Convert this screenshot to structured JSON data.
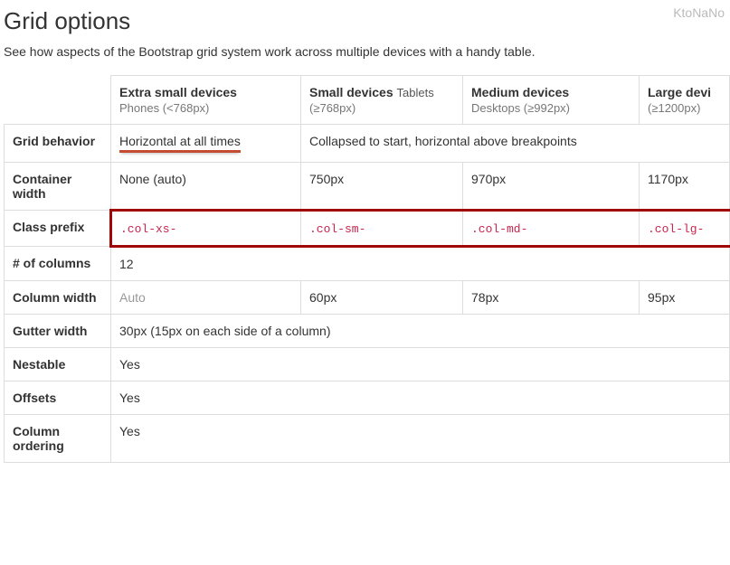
{
  "watermark": "KtoNaNo",
  "title": "Grid options",
  "lead": "See how aspects of the Bootstrap grid system work across multiple devices with a handy table.",
  "columns": [
    {
      "name": "Extra small devices",
      "tag": "",
      "sub": "Phones (<768px)"
    },
    {
      "name": "Small devices",
      "tag": "Tablets",
      "sub": "(≥768px)"
    },
    {
      "name": "Medium devices",
      "tag": "",
      "sub": "Desktops (≥992px)"
    },
    {
      "name": "Large devi",
      "tag": "",
      "sub": "(≥1200px)"
    }
  ],
  "rows": {
    "grid_behavior": {
      "label": "Grid behavior",
      "xs": "Horizontal at all times",
      "rest": "Collapsed to start, horizontal above breakpoints"
    },
    "container_width": {
      "label": "Container width",
      "xs": "None (auto)",
      "sm": "750px",
      "md": "970px",
      "lg": "1170px"
    },
    "class_prefix": {
      "label": "Class prefix",
      "xs": ".col-xs-",
      "sm": ".col-sm-",
      "md": ".col-md-",
      "lg": ".col-lg-"
    },
    "num_columns": {
      "label": "# of columns",
      "value": "12"
    },
    "column_width": {
      "label": "Column width",
      "xs": "Auto",
      "sm": "60px",
      "md": "78px",
      "lg": "95px"
    },
    "gutter_width": {
      "label": "Gutter width",
      "value": "30px (15px on each side of a column)"
    },
    "nestable": {
      "label": "Nestable",
      "value": "Yes"
    },
    "offsets": {
      "label": "Offsets",
      "value": "Yes"
    },
    "ordering": {
      "label": "Column ordering",
      "value": "Yes"
    }
  }
}
